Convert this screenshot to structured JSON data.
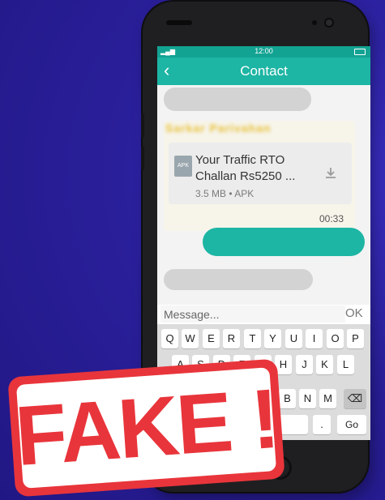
{
  "status_bar": {
    "time": "12:00"
  },
  "app_bar": {
    "back_icon": "chevron-left-icon",
    "title": "Contact"
  },
  "message": {
    "sender_blurred": "Sarkar Parivahan",
    "file_name": "Your Traffic RTO Challan Rs5250 ...",
    "file_type_icon": "APK",
    "file_meta": "3.5 MB • APK",
    "download_icon": "download-icon",
    "time": "00:33"
  },
  "composer": {
    "placeholder": "Message...",
    "send_label": "OK"
  },
  "keyboard": {
    "row1": [
      "Q",
      "W",
      "E",
      "R",
      "T",
      "Y",
      "U",
      "I",
      "O",
      "P"
    ],
    "row2": [
      "A",
      "S",
      "D",
      "F",
      "G",
      "H",
      "J",
      "K",
      "L"
    ],
    "row3": [
      "B",
      "N",
      "M"
    ],
    "backspace_icon": "backspace-icon",
    "period": ".",
    "go_label": "Go"
  },
  "stamp": {
    "text": "FAKE !"
  },
  "colors": {
    "teal": "#1db5a4",
    "teal_dark": "#13a393",
    "stamp_red": "#e8353b",
    "background": "#251c8a"
  }
}
